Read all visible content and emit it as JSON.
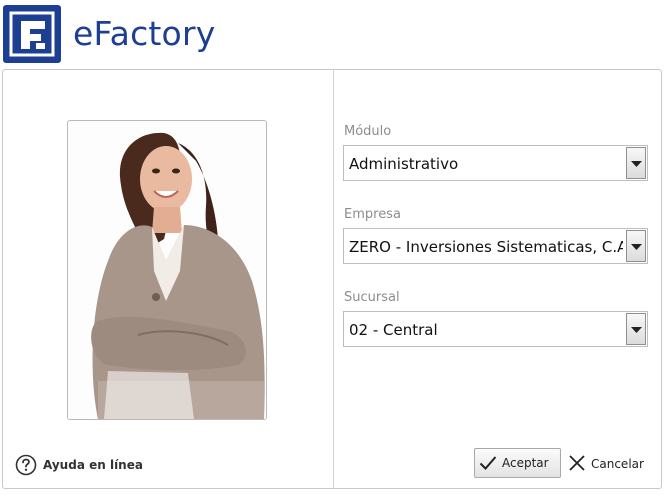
{
  "app": {
    "title": "eFactory",
    "brand_color": "#1c3f94"
  },
  "fields": {
    "modulo": {
      "label": "Módulo",
      "value": "Administrativo"
    },
    "empresa": {
      "label": "Empresa",
      "value": "ZERO - Inversiones Sistematicas, C.A."
    },
    "sucursal": {
      "label": "Sucursal",
      "value": "02 - Central"
    }
  },
  "help": {
    "label": "Ayuda en línea",
    "icon": "question-circle-icon"
  },
  "actions": {
    "accept_label": "Aceptar",
    "cancel_label": "Cancelar"
  }
}
